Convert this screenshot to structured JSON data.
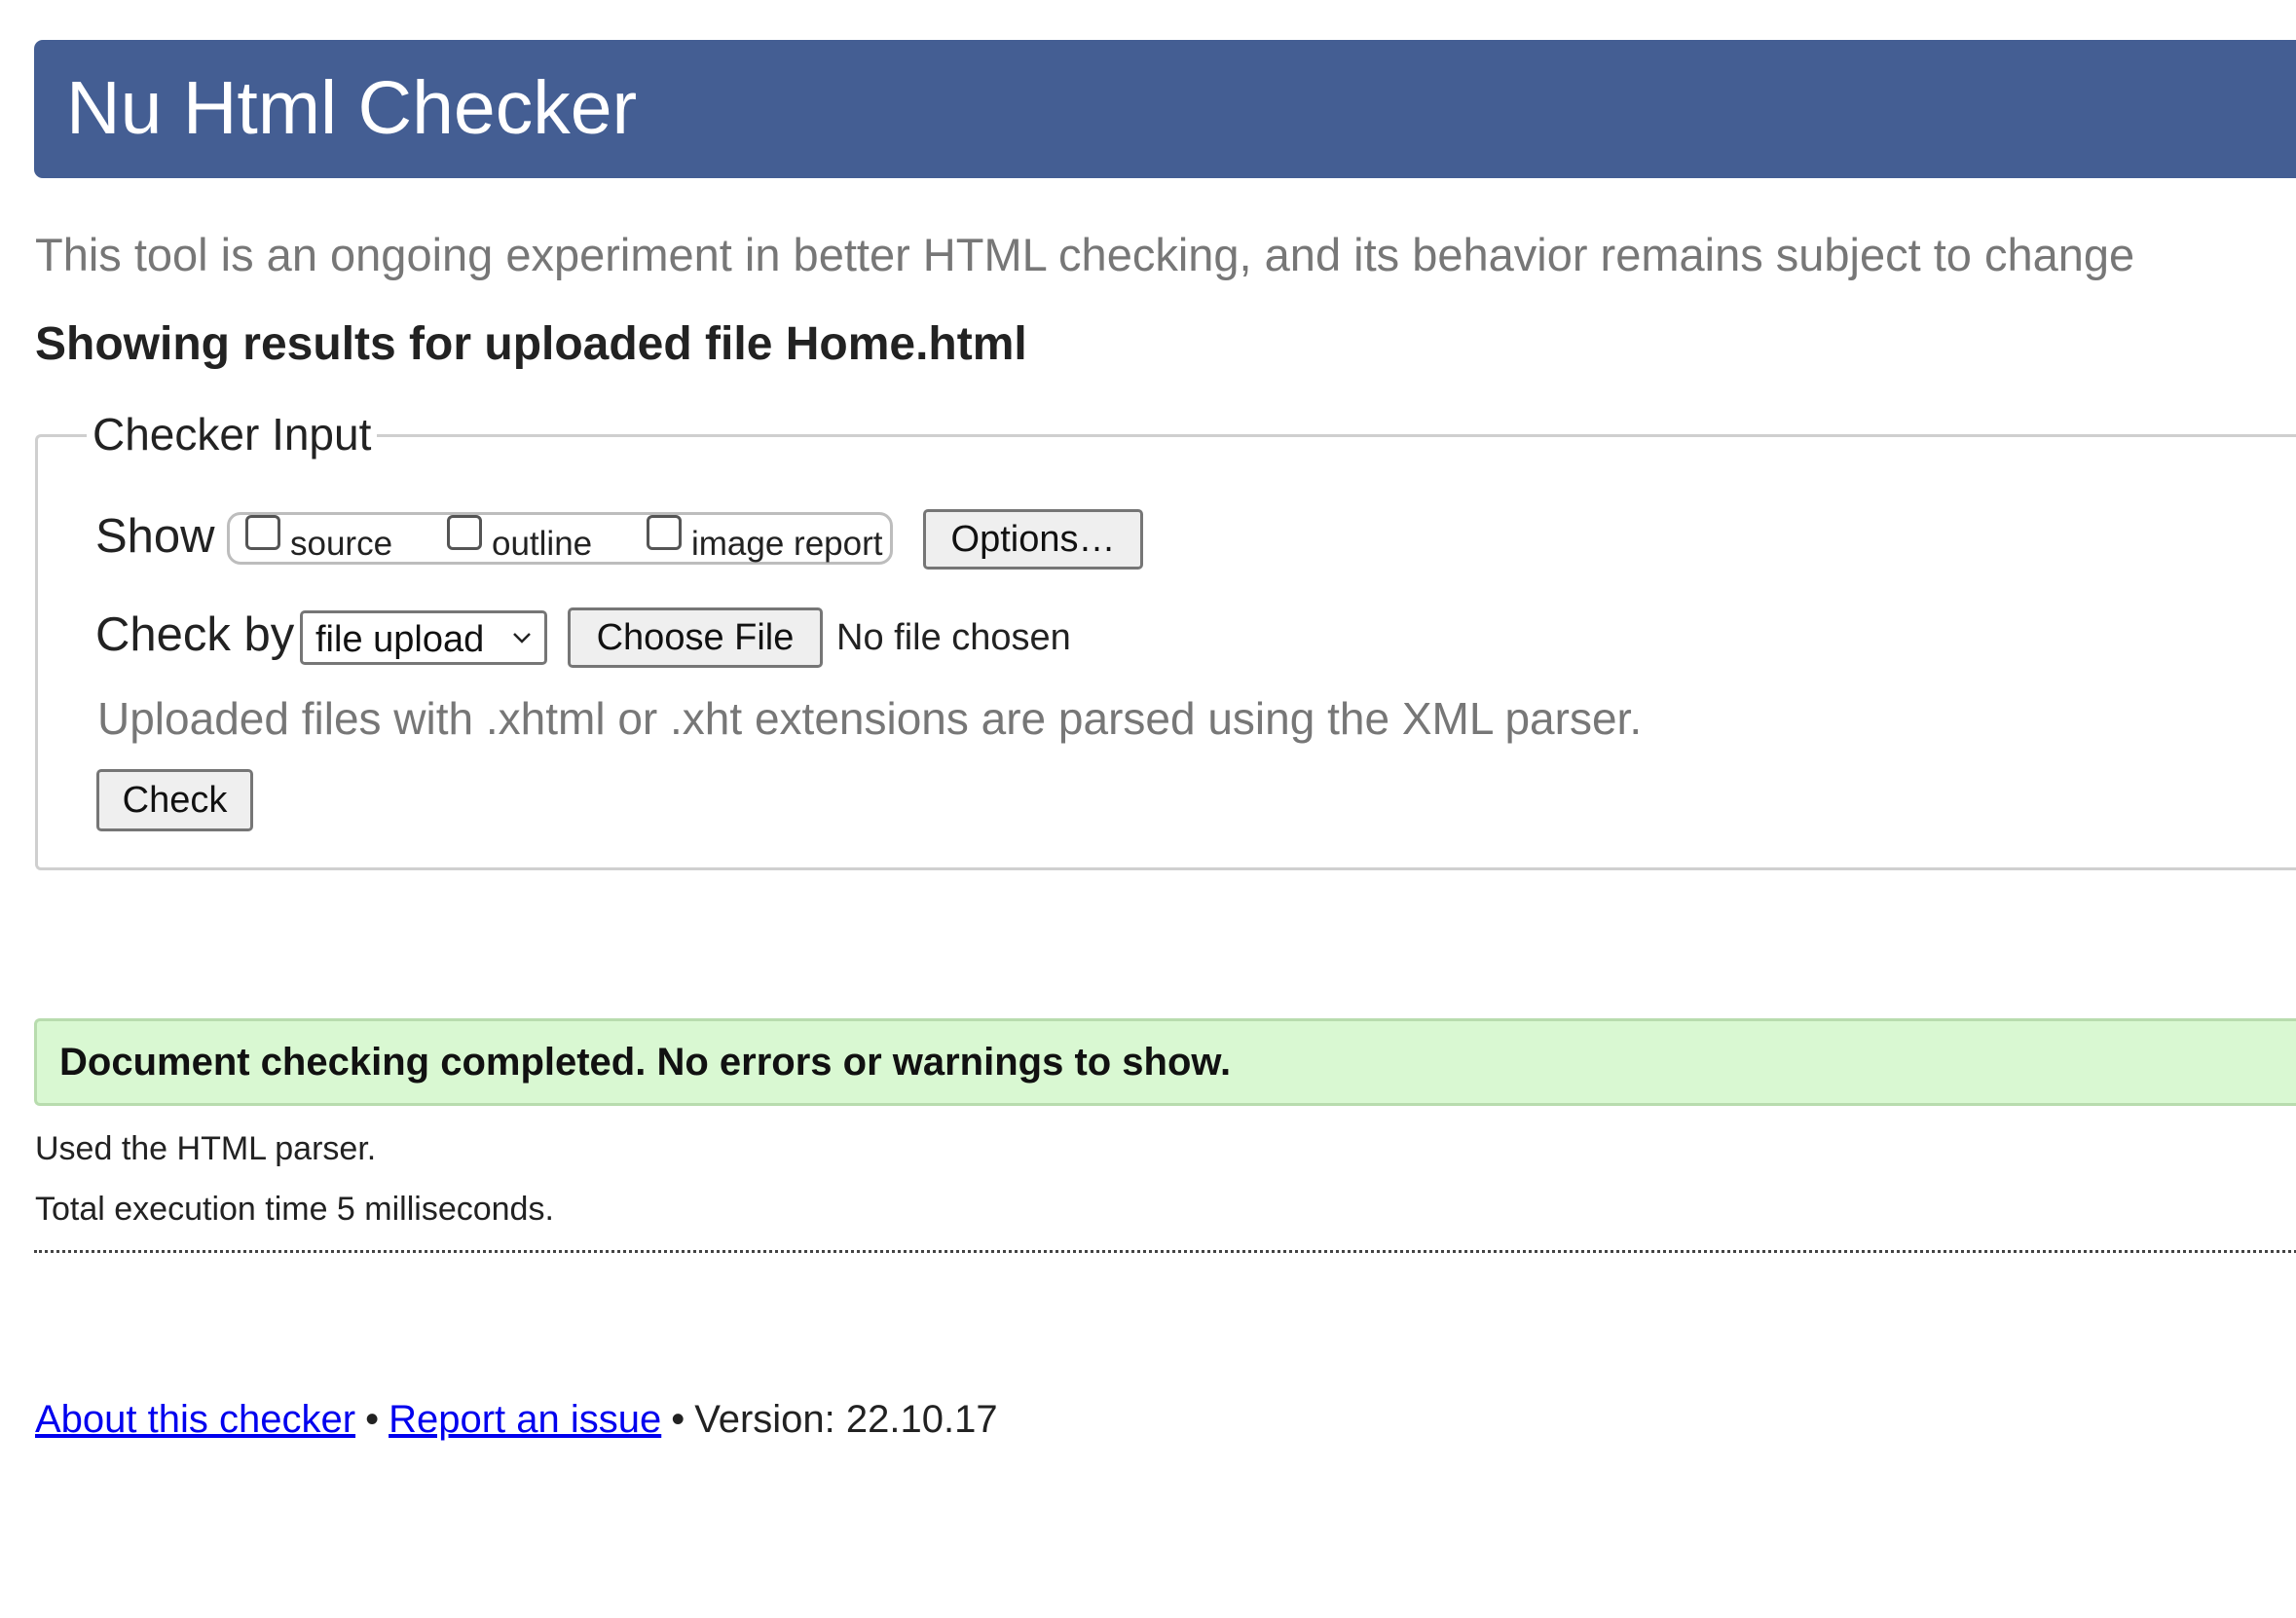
{
  "header": {
    "title": "Nu Html Checker",
    "bg_color": "#445e93"
  },
  "tagline": "This tool is an ongoing experiment in better HTML checking, and its behavior remains subject to change",
  "results_heading": {
    "prefix": "Showing results for uploaded file ",
    "file_name": "Home.html"
  },
  "checker_input": {
    "legend": "Checker Input",
    "show_label": "Show",
    "show_options": [
      {
        "label": "source",
        "checked": false
      },
      {
        "label": "outline",
        "checked": false
      },
      {
        "label": "image report",
        "checked": false
      }
    ],
    "options_button": "Options…",
    "check_by_label": "Check by",
    "check_by_selected": "file upload",
    "choose_file_button": "Choose File",
    "no_file_text": "No file chosen",
    "upload_note": "Uploaded files with .xhtml or .xht extensions are parsed using the XML parser.",
    "check_button": "Check"
  },
  "result": {
    "message": "Document checking completed. No errors or warnings to show.",
    "bg_color": "#d9f8d2",
    "parser_text": "Used the HTML parser.",
    "execution_text": "Total execution time 5 milliseconds."
  },
  "footer": {
    "about_link": "About this checker",
    "separator": "•",
    "report_link": "Report an issue",
    "version_text": "Version: 22.10.17"
  }
}
